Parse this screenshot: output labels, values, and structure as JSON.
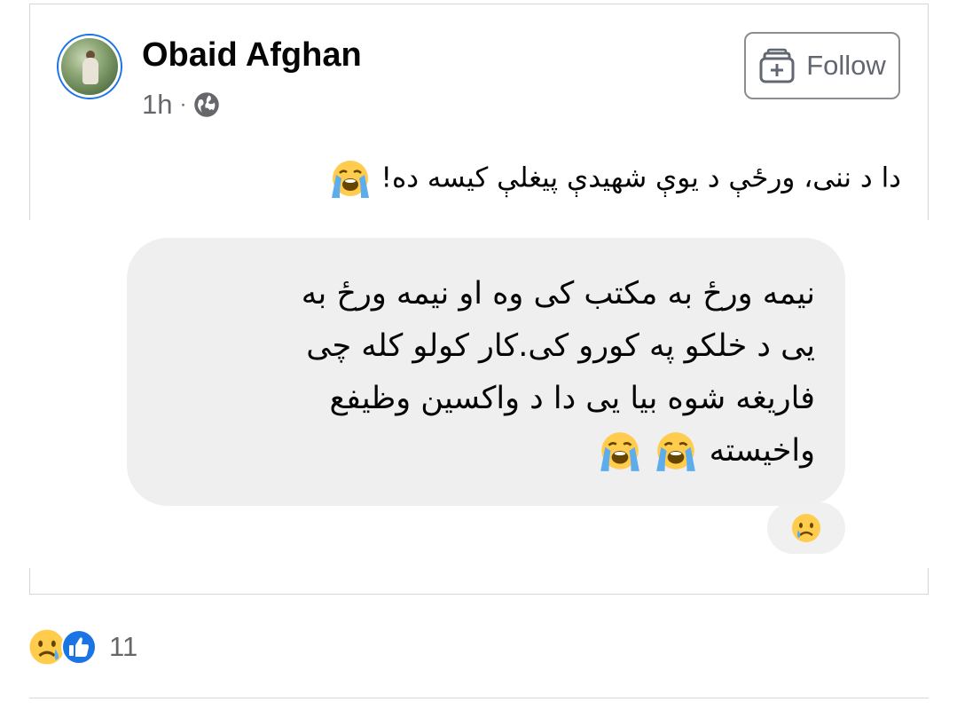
{
  "post": {
    "author": "Obaid Afghan",
    "time": "1h",
    "separator": "·",
    "privacy_icon": "globe-icon",
    "follow_label": "Follow",
    "caption": "دا د ننی، ورځې د یوې شهیدې پیغلې کیسه ده!"
  },
  "shared_message": {
    "lines": [
      "نیمه ورځ به مکتب کی وه او نیمه ورځ به",
      "یی د خلکو په کورو کی.کار کولو کله چی",
      "فاریغه شوه بیا  یی دا د واکسین وظیفع",
      "واخیسته"
    ],
    "message_reaction": "crying-face"
  },
  "reactions": {
    "icons": [
      "sad-face",
      "like"
    ],
    "count": "11"
  },
  "colors": {
    "accent": "#1b74e4",
    "text_secondary": "#65676b",
    "bubble_bg": "#efefef"
  }
}
